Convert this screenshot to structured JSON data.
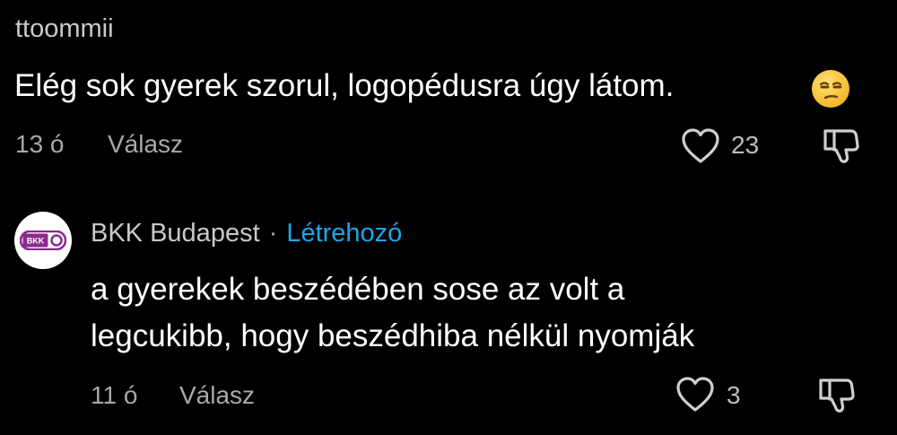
{
  "comments": [
    {
      "username": "ttoommii",
      "text": "Elég sok gyerek szorul, logopédusra úgy látom.",
      "emoji": "unamused-face",
      "time": "13 ó",
      "reply_label": "Válasz",
      "like_count": "23"
    },
    {
      "username": "BKK Budapest",
      "separator": "·",
      "creator_badge": "Létrehozó",
      "avatar_text": "BKK",
      "text_line1": "a gyerekek beszédében sose az volt a",
      "text_line2": "legcukibb, hogy beszédhiba nélkül nyomják",
      "time": "11 ó",
      "reply_label": "Válasz",
      "like_count": "3"
    }
  ],
  "icons": {
    "like": "heart-outline-icon",
    "dislike": "thumbs-down-outline-icon"
  },
  "colors": {
    "background": "#000000",
    "creator_badge": "#1aa7e6",
    "bkk_purple": "#8a2a8c"
  }
}
